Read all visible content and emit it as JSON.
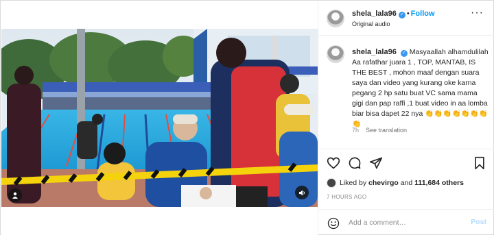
{
  "post": {
    "username": "shela_lala96",
    "verified_mark": "✓",
    "dot": "•",
    "follow_label": "Follow",
    "audio_label": "Original audio",
    "more_label": "···",
    "caption_username": "shela_lala96",
    "caption_text": "Masyaallah alhamdulilah Aa rafathar juara 1 , TOP, MANTAB, IS THE BEST , mohon maaf dengan suara saya dan video yang kurang oke karna pegang 2 hp satu buat VC sama mama gigi dan pap raffi ,1 buat video in aa lomba biar bisa dapet 22 nya 👏👏👏👏👏👏👏👏",
    "caption_age": "7h",
    "see_translation_label": "See translation",
    "likes_prefix": "Liked by ",
    "likes_user": "chevirgo",
    "likes_and": " and ",
    "likes_others": "111,684 others",
    "timestamp": "7 HOURS AGO"
  },
  "comment": {
    "placeholder": "Add a comment…",
    "post_label": "Post"
  },
  "icons": {
    "like": "heart-icon",
    "comment": "comment-icon",
    "share": "paper-plane-icon",
    "save": "bookmark-icon",
    "emoji": "smiley-icon",
    "tag": "user-tag-icon",
    "sound": "speaker-muted-icon"
  },
  "colors": {
    "accent": "#0095f6",
    "verified": "#3897f0",
    "muted_text": "#8e8e8e",
    "post_disabled": "#b3dbff"
  }
}
